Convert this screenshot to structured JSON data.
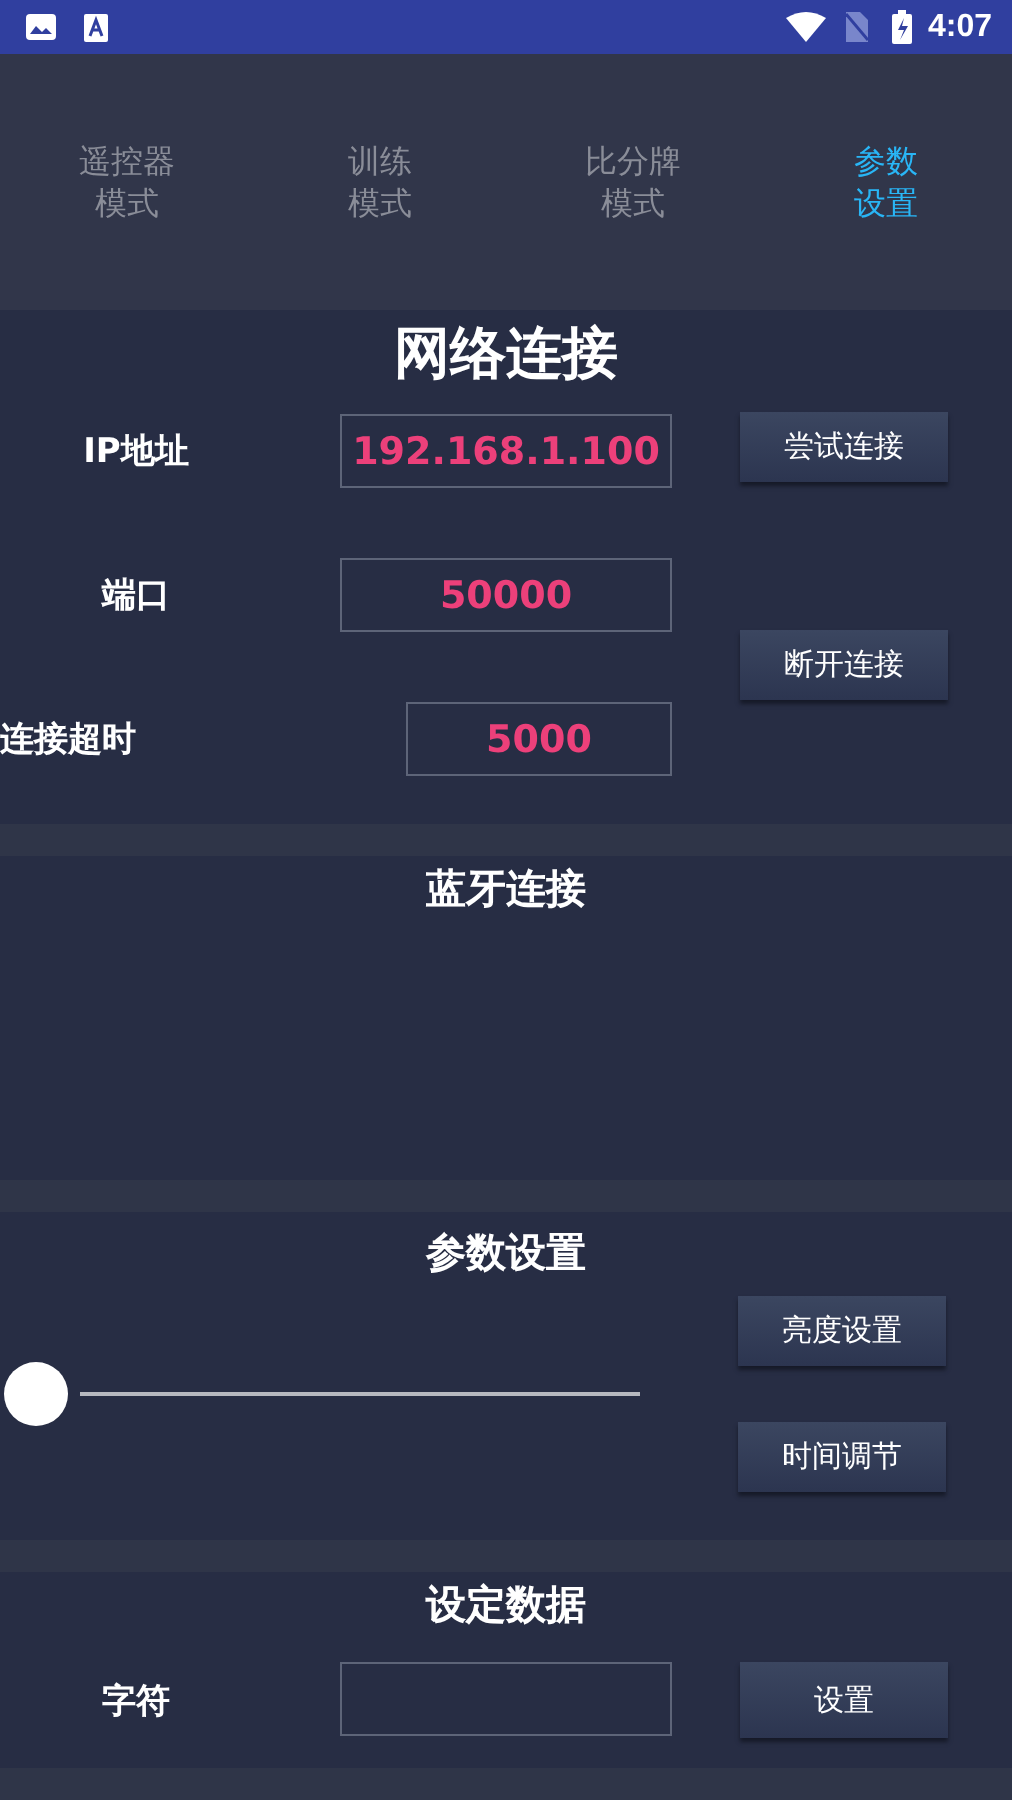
{
  "status_bar": {
    "time": "4:07"
  },
  "tabs": [
    {
      "lines": [
        "遥控器",
        "模式"
      ],
      "selected": false
    },
    {
      "lines": [
        "训练",
        "模式"
      ],
      "selected": false
    },
    {
      "lines": [
        "比分牌",
        "模式"
      ],
      "selected": false
    },
    {
      "lines": [
        "参数",
        "设置"
      ],
      "selected": true
    }
  ],
  "sections": [
    {
      "kind": "network",
      "title": "网络连接",
      "fields": [
        {
          "label": "IP地址",
          "value": "192.168.1.100"
        },
        {
          "label": "端口",
          "value": "50000"
        },
        {
          "label": "连接超时",
          "value": "5000"
        }
      ],
      "buttons": [
        "尝试连接",
        "断开连接"
      ]
    },
    {
      "kind": "empty",
      "title": "蓝牙连接"
    },
    {
      "kind": "slider",
      "title": "参数设置",
      "slider": {
        "level": 0
      },
      "buttons": [
        "亮度设置",
        "时间调节"
      ]
    },
    {
      "kind": "form",
      "title": "设定数据",
      "fields": [
        {
          "label": "字符"
        }
      ],
      "buttons": [
        "设置"
      ]
    }
  ]
}
